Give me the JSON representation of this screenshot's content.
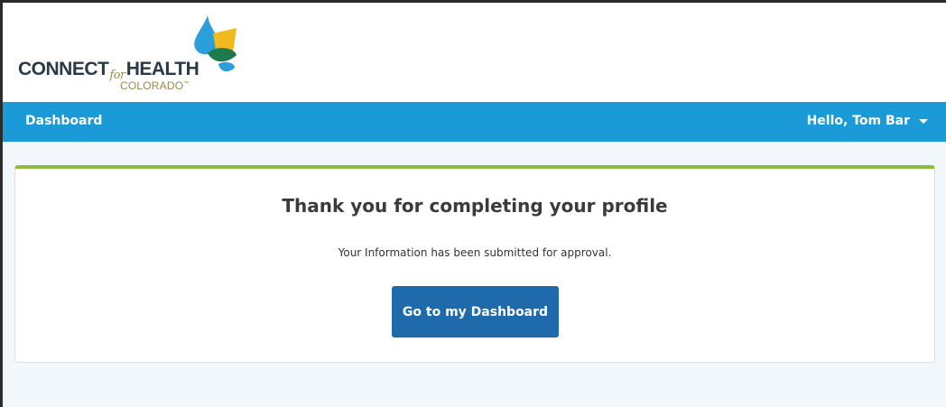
{
  "brand": {
    "name_part1": "CONNECT",
    "name_for": "for",
    "name_part2": "HEALTH",
    "subtitle": "COLORADO",
    "trademark": "™",
    "colors": {
      "blue": "#1a9ad6",
      "yellow": "#f2b91f",
      "green": "#1e7a4a",
      "navy": "#2a3a47",
      "gold": "#9a8a4a"
    }
  },
  "navbar": {
    "dashboard_label": "Dashboard",
    "user_greeting": "Hello, Tom Bar",
    "user_menu_icon": "chevron-down-icon",
    "background_color": "#1a9ad6"
  },
  "confirmation": {
    "title": "Thank you for completing your profile",
    "message": "Your Information has been submitted for approval.",
    "button_label": "Go to my Dashboard",
    "accent_color": "#8dbd3c",
    "button_color": "#1f6aaa"
  }
}
